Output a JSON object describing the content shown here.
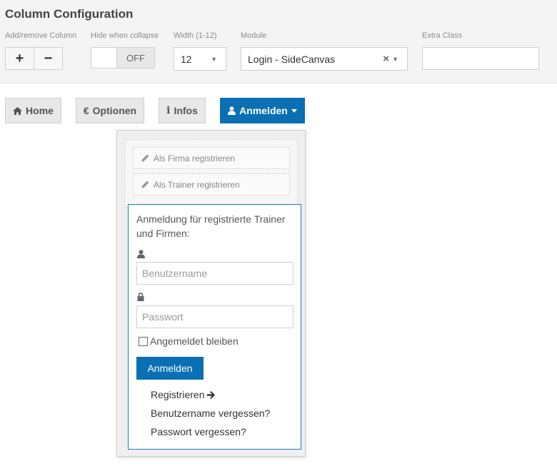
{
  "config": {
    "title": "Column Configuration",
    "labels": {
      "add_remove": "Add/remove Column",
      "hide_collapse": "Hide when collapse",
      "width": "Width (1-12)",
      "module": "Module",
      "extra_class": "Extra Class"
    },
    "add_symbol": "+",
    "remove_symbol": "−",
    "toggle_state": "OFF",
    "width_value": "12",
    "module_value": "Login - SideCanvas",
    "module_clear": "×",
    "extra_class_value": ""
  },
  "nav": {
    "home": "Home",
    "options_symbol": "€",
    "options": "Optionen",
    "infos_symbol": "i",
    "infos": "Infos",
    "login": "Anmelden"
  },
  "dropdown": {
    "register_company": "Als Firma registrieren",
    "register_trainer": "Als Trainer registrieren",
    "intro": "Anmeldung für registrierte Trainer und Firmen:",
    "username_placeholder": "Benutzername",
    "password_placeholder": "Passwort",
    "remember_me": "Angemeldet bleiben",
    "remember_checked": false,
    "submit": "Anmelden",
    "links": {
      "register": "Registrieren",
      "forgot_username": "Benutzername vergessen?",
      "forgot_password": "Passwort vergessen?"
    }
  },
  "colors": {
    "primary": "#0a6fb3",
    "login_border": "#1b7bb5",
    "panel_bg": "#f4f4f4"
  }
}
